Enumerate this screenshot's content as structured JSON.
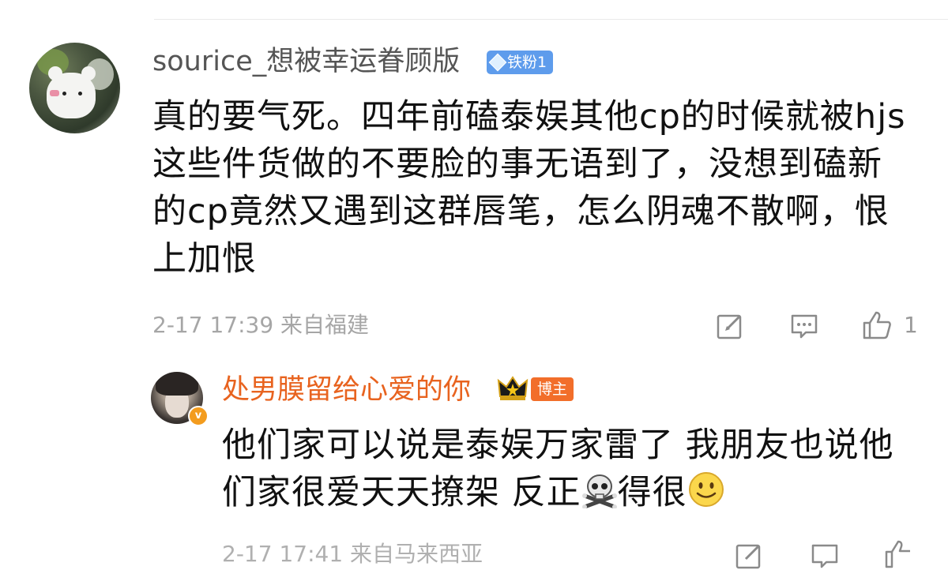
{
  "comment": {
    "username": "sourice_想被幸运眷顾版",
    "fan_badge": "铁粉1",
    "text": "真的要气死。四年前磕泰娱其他cp的时候就被hjs这些件货做的不要脸的事无语到了，没想到磕新的cp竟然又遇到这群唇笔，怎么阴魂不散啊，恨上加恨",
    "timestamp": "2-17 17:39",
    "location": "来自福建",
    "like_count": "1"
  },
  "reply": {
    "username": "处男膜留给心爱的你",
    "role_badge": "博主",
    "text_part1": "他们家可以说是泰娱万家雷了 我朋友也说他们家很爱天天撩架 反正",
    "text_part2": "得很",
    "timestamp": "2-17 17:41",
    "location": "来自马来西亚"
  },
  "icons": {
    "edit": "edit-icon",
    "reply": "comment-icon",
    "like": "thumbs-up-icon",
    "skull": "skull-crossbones-emoji",
    "smile": "smiley-emoji",
    "crown": "crown-icon",
    "verified": "verified-v-icon"
  },
  "colors": {
    "reply_username": "#e8631f",
    "fan_badge": "#5e9cec",
    "author_badge": "#f26e2a"
  }
}
